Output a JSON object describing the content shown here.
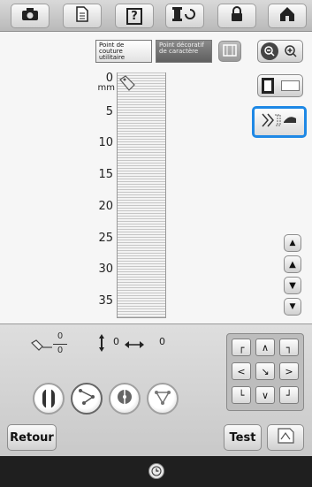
{
  "toolbar": {
    "icons": [
      "camera-icon",
      "page-icon",
      "help-icon",
      "thread-icon",
      "lock-icon",
      "home-icon"
    ],
    "help_text": "?"
  },
  "tabs": {
    "utility": "Point de couture utilitaire",
    "decorative": "Point décoratif de caractère"
  },
  "ruler": {
    "unit": "mm",
    "marks": [
      "0",
      "5",
      "10",
      "15",
      "20",
      "25",
      "30",
      "35"
    ]
  },
  "settings": {
    "length_top": "0",
    "length_bottom": "0",
    "vertical_value": "0",
    "horizontal_value": "0"
  },
  "buttons": {
    "back": "Retour",
    "test": "Test"
  },
  "colors": {
    "highlight": "#1e88e5"
  }
}
